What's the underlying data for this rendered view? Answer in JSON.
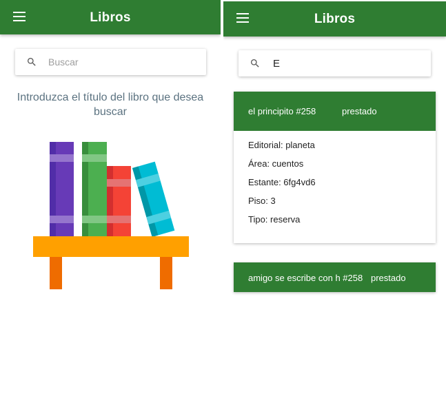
{
  "left_screen": {
    "appbar": {
      "title": "Libros",
      "menu_icon": "menu-icon"
    },
    "search": {
      "placeholder": "Buscar",
      "value": "",
      "icon": "search-icon"
    },
    "hint": "Introduzca el título del libro que desea buscar",
    "illustration": "books-on-shelf-illustration"
  },
  "right_screen": {
    "appbar": {
      "title": "Libros",
      "menu_icon": "menu-icon"
    },
    "search": {
      "placeholder": "",
      "value": "E",
      "icon": "search-icon"
    },
    "results": [
      {
        "title": "el principito #258",
        "status": "prestado",
        "expanded": true,
        "details": [
          "Editorial: planeta",
          "Área: cuentos",
          "Estante: 6fg4vd6",
          "Piso: 3",
          "Tipo: reserva"
        ]
      },
      {
        "title": "amigo se escribe con h #258",
        "status": "prestado",
        "expanded": false,
        "details": []
      }
    ]
  },
  "colors": {
    "primary": "#2f7d32",
    "hint_text": "#5b7280",
    "shelf": "#ffa000",
    "shelf_legs": "#ef6c00",
    "book_purple": "#673ab7",
    "book_green": "#4caf50",
    "book_red": "#f44336",
    "book_cyan": "#00bcd4"
  }
}
